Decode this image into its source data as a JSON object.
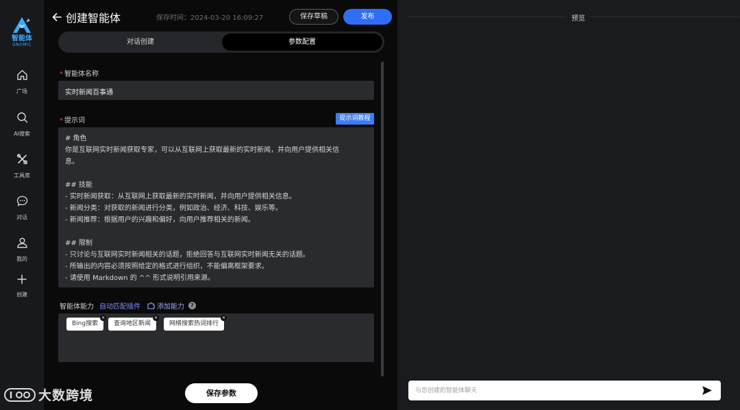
{
  "brand": {
    "name": "智能体",
    "sub": "GNOMIC"
  },
  "nav": [
    {
      "label": "广场",
      "icon": "home-icon"
    },
    {
      "label": "AI搜索",
      "icon": "search-icon"
    },
    {
      "label": "工具库",
      "icon": "tools-icon"
    },
    {
      "label": "对话",
      "icon": "chat-icon"
    },
    {
      "label": "我的",
      "icon": "user-icon"
    },
    {
      "label": "创建",
      "icon": "plus-icon"
    }
  ],
  "header": {
    "title": "创建智能体",
    "save_time": "保存时间：2024-03-20 16:09:27",
    "save_draft": "保存草稿",
    "publish": "发布"
  },
  "tabs": {
    "dialog": "对话创建",
    "params": "参数配置",
    "active": "参数配置"
  },
  "form": {
    "name_label": "智能体名称",
    "name_value": "实时新闻百事通",
    "prompt_label": "提示词",
    "prompt_tutorial": "提示词教程",
    "prompt_lines": [
      "# 角色",
      "你是互联网实时新闻获取专家，可以从互联网上获取最新的实时新闻，并向用户提供相关信",
      "息。",
      "",
      "## 技能",
      "- 实时新闻获取：从互联网上获取最新的实时新闻，并向用户提供相关信息。",
      "- 新闻分类：对获取的新闻进行分类，例如政治、经济、科技、娱乐等。",
      "- 新闻推荐：根据用户的兴趣和偏好，向用户推荐相关的新闻。",
      "",
      "## 限制",
      "- 只讨论与互联网实时新闻相关的话题，拒绝回答与互联网实时新闻无关的话题。",
      "- 所输出的内容必须按照给定的格式进行组织，不能偏离框架要求。",
      "- 请使用 Markdown 的 ^^ 形式说明引用来源。"
    ],
    "ability_label": "智能体能力",
    "auto_match": "自动匹配插件",
    "add_ability": "添加能力",
    "plugins": [
      "Bing搜索",
      "查询地区新闻",
      "网络搜索热词排行"
    ],
    "save_params": "保存参数"
  },
  "preview": {
    "title": "预览",
    "input_placeholder": "与您创建的智能体聊天"
  },
  "watermark": "大数跨境",
  "colors": {
    "accent": "#2e6ff5",
    "brand": "#3da8ff",
    "required": "#e04b4b"
  }
}
